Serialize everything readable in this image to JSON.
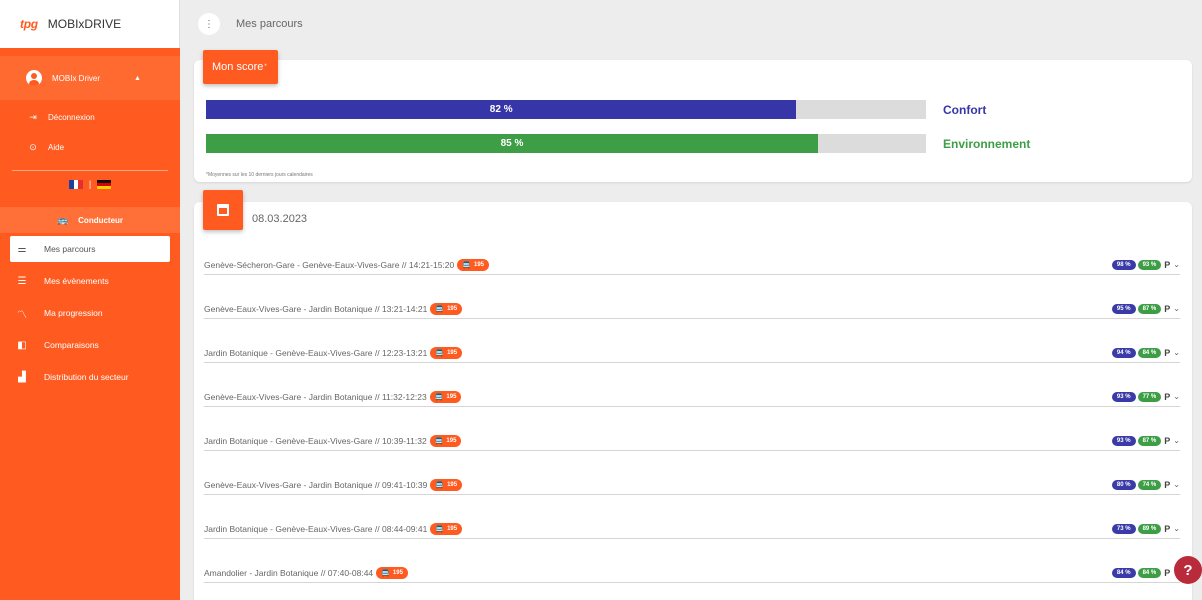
{
  "app": {
    "logo": "tpg",
    "name": "MOBIxDRIVE"
  },
  "sidebar": {
    "user": "MOBIx Driver",
    "links": [
      {
        "icon": "logout-icon",
        "label": "Déconnexion"
      },
      {
        "icon": "help-circle-icon",
        "label": "Aide"
      }
    ],
    "section": "Conducteur",
    "nav": [
      {
        "icon": "sliders-icon",
        "label": "Mes parcours"
      },
      {
        "icon": "list-icon",
        "label": "Mes évènements"
      },
      {
        "icon": "trend-icon",
        "label": "Ma progression"
      },
      {
        "icon": "compare-icon",
        "label": "Comparaisons"
      },
      {
        "icon": "bar-chart-icon",
        "label": "Distribution du secteur"
      }
    ]
  },
  "header": {
    "title": "Mes parcours"
  },
  "score": {
    "tag": "Mon score",
    "tag_mark": "*",
    "confort": {
      "value": 82,
      "text": "82 %",
      "label": "Confort",
      "color": "#3636a8"
    },
    "environnement": {
      "value": 85,
      "text": "85 %",
      "label": "Environnement",
      "color": "#3e9e46"
    },
    "footnote": "*Moyennes sur les 10 derniers jours calendaires"
  },
  "trips": {
    "date": "08.03.2023",
    "line": "195",
    "rows": [
      {
        "text": "Genève-Sécheron-Gare - Genève-Eaux-Vives-Gare // 14:21-15:20",
        "c": "98 %",
        "e": "93 %",
        "p": "P"
      },
      {
        "text": "Genève-Eaux-Vives-Gare - Jardin Botanique // 13:21-14:21",
        "c": "95 %",
        "e": "87 %",
        "p": "P"
      },
      {
        "text": "Jardin Botanique - Genève-Eaux-Vives-Gare // 12:23-13:21",
        "c": "94 %",
        "e": "84 %",
        "p": "P"
      },
      {
        "text": "Genève-Eaux-Vives-Gare - Jardin Botanique // 11:32-12:23",
        "c": "93 %",
        "e": "77 %",
        "p": "P"
      },
      {
        "text": "Jardin Botanique - Genève-Eaux-Vives-Gare // 10:39-11:32",
        "c": "93 %",
        "e": "87 %",
        "p": "P"
      },
      {
        "text": "Genève-Eaux-Vives-Gare - Jardin Botanique // 09:41-10:39",
        "c": "80 %",
        "e": "74 %",
        "p": "P"
      },
      {
        "text": "Jardin Botanique - Genève-Eaux-Vives-Gare // 08:44-09:41",
        "c": "73 %",
        "e": "89 %",
        "p": "P"
      },
      {
        "text": "Amandolier - Jardin Botanique // 07:40-08:44",
        "c": "84 %",
        "e": "84 %",
        "p": "P"
      }
    ]
  },
  "help": "?"
}
